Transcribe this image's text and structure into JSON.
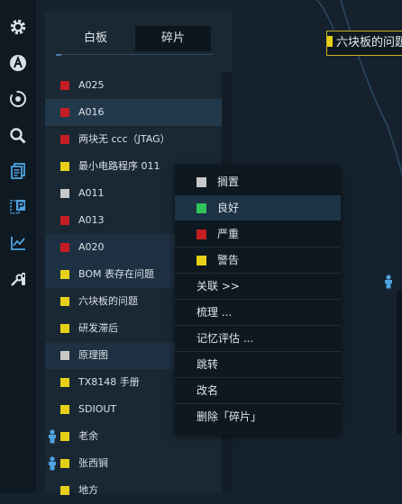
{
  "tabs": {
    "whiteboard": "白板",
    "fragments": "碎片"
  },
  "colors": {
    "red": "#c41e24",
    "yellow": "#e6d017",
    "gray": "#c8c8c8",
    "green": "#2ec45a",
    "accent_blue": "#4fa3e0"
  },
  "list": [
    {
      "label": "A025",
      "color": "red"
    },
    {
      "label": "A016",
      "color": "red",
      "state": "selected"
    },
    {
      "label": "两块无 ccc（JTAG）",
      "color": "red"
    },
    {
      "label": "最小电路程序 011",
      "color": "yellow"
    },
    {
      "label": "A011",
      "color": "gray"
    },
    {
      "label": "A013",
      "color": "red"
    },
    {
      "label": "A020",
      "color": "red",
      "state": "highlight"
    },
    {
      "label": "BOM 表存在问题",
      "color": "yellow",
      "state": "highlight"
    },
    {
      "label": "六块板的问题",
      "color": "yellow"
    },
    {
      "label": "研发滞后",
      "color": "yellow"
    },
    {
      "label": "原理图",
      "color": "gray",
      "state": "highlight"
    },
    {
      "label": "TX8148 手册",
      "color": "yellow"
    },
    {
      "label": "SDIOUT",
      "color": "yellow"
    },
    {
      "label": "老余",
      "color": "yellow",
      "person": true
    },
    {
      "label": "张西锏",
      "color": "yellow",
      "person": true
    },
    {
      "label": "地方",
      "color": "yellow"
    }
  ],
  "context_menu": {
    "shelve": "搁置",
    "good": "良好",
    "severe": "严重",
    "warning": "警告",
    "relate": "关联 >>",
    "organize": "梳理 ...",
    "memory_eval": "记忆评估 ...",
    "jump": "跳转",
    "rename": "改名",
    "delete": "删除「碎片」"
  },
  "canvas_node": {
    "label": "六块板的问题"
  },
  "toolbar_icons": [
    "gear-icon",
    "a-circle-icon",
    "target-icon",
    "search-icon",
    "documents-icon",
    "p-document-icon",
    "chart-icon",
    "tools-icon"
  ]
}
